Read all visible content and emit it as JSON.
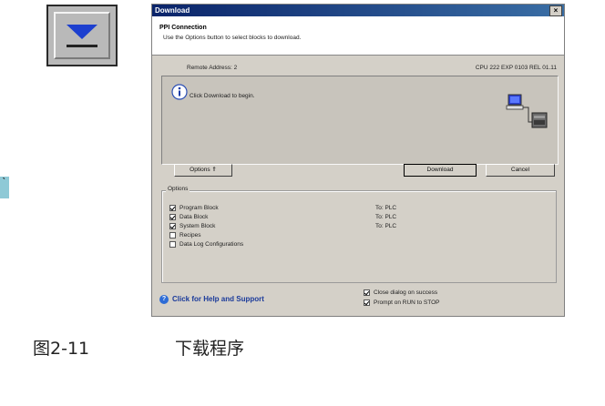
{
  "dialog": {
    "title": "Download",
    "close_glyph": "×",
    "header_title": "PPI Connection",
    "header_subtitle": "Use the Options button to select blocks to download.",
    "remote_address": "Remote Address: 2",
    "cpu_info": "CPU 222 EXP 0103 REL 01.11",
    "message": "Click Download to begin.",
    "buttons": {
      "options": "Options ⇑",
      "download": "Download",
      "cancel": "Cancel"
    },
    "options_legend": "Options",
    "options": [
      {
        "label": "Program Block",
        "checked": true,
        "target": "To:  PLC"
      },
      {
        "label": "Data Block",
        "checked": true,
        "target": "To:  PLC"
      },
      {
        "label": "System Block",
        "checked": true,
        "target": "To:  PLC"
      },
      {
        "label": "Recipes",
        "checked": false,
        "target": ""
      },
      {
        "label": "Data Log Configurations",
        "checked": false,
        "target": ""
      }
    ],
    "help_link": "Click for Help and Support",
    "close_on_success": {
      "label": "Close dialog on success",
      "checked": true
    },
    "prompt_run_stop": {
      "label": "Prompt on RUN to STOP",
      "checked": true
    },
    "icons": [
      "info-icon",
      "pc-plc-icon",
      "help-icon"
    ]
  },
  "toolbar": {
    "download_icon": "download-arrow-icon",
    "arrow_color": "#1c3fcf"
  },
  "caption": {
    "figure_number": "图2-11",
    "figure_title": "下载程序"
  }
}
